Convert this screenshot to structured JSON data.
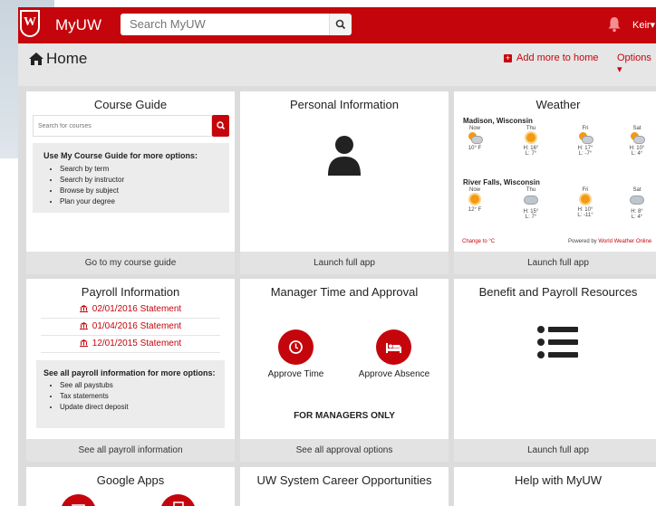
{
  "header": {
    "logo_letter": "W",
    "app_title": "MyUW",
    "search_placeholder": "Search MyUW",
    "user_name": "Keir▾"
  },
  "subheader": {
    "page_title": "Home",
    "add_more_label": "Add more to home",
    "options_label": "Options ▾"
  },
  "cards": {
    "course_guide": {
      "title": "Course Guide",
      "search_placeholder": "Search for courses",
      "box_heading": "Use My Course Guide for more options:",
      "box_items": [
        "Search by term",
        "Search by instructor",
        "Browse by subject",
        "Plan your degree"
      ],
      "footer": "Go to my course guide"
    },
    "personal_information": {
      "title": "Personal Information",
      "footer": "Launch full app"
    },
    "weather": {
      "title": "Weather",
      "locations": [
        {
          "name": "Madison, Wisconsin",
          "days": [
            {
              "day": "Now",
              "icon": "partly-cloudy-icon",
              "hi": "10° F",
              "lo": ""
            },
            {
              "day": "Thu",
              "icon": "sun-icon",
              "hi": "H: 16°",
              "lo": "L: 7°"
            },
            {
              "day": "Fri",
              "icon": "partly-cloudy-icon",
              "hi": "H: 17°",
              "lo": "L: -7°"
            },
            {
              "day": "Sat",
              "icon": "partly-cloudy-icon",
              "hi": "H: 10°",
              "lo": "L: 4°"
            }
          ]
        },
        {
          "name": "River Falls, Wisconsin",
          "days": [
            {
              "day": "Now",
              "icon": "sun-icon",
              "hi": "12° F",
              "lo": ""
            },
            {
              "day": "Thu",
              "icon": "cloud-icon",
              "hi": "H: 15°",
              "lo": "L: 7°"
            },
            {
              "day": "Fri",
              "icon": "sun-icon",
              "hi": "H: 10°",
              "lo": "L: -11°"
            },
            {
              "day": "Sat",
              "icon": "cloud-icon",
              "hi": "H: 8°",
              "lo": "L: 4°"
            }
          ]
        }
      ],
      "change_units": "Change to °C",
      "powered_prefix": "Powered by ",
      "powered_link": "World Weather Online",
      "footer": "Launch full app"
    },
    "payroll": {
      "title": "Payroll Information",
      "statements": [
        "02/01/2016 Statement",
        "01/04/2016 Statement",
        "12/01/2015 Statement"
      ],
      "box_heading": "See all payroll information for more options:",
      "box_items": [
        "See all paystubs",
        "Tax statements",
        "Update direct deposit"
      ],
      "footer": "See all payroll information"
    },
    "manager_time": {
      "title": "Manager Time and Approval",
      "approve_time": "Approve Time",
      "approve_absence": "Approve Absence",
      "note": "FOR MANAGERS ONLY",
      "footer": "See all approval options"
    },
    "benefit": {
      "title": "Benefit and Payroll Resources",
      "footer": "Launch full app"
    },
    "google_apps": {
      "title": "Google Apps"
    },
    "career": {
      "title": "UW System Career Opportunities"
    },
    "help": {
      "title": "Help with MyUW"
    }
  },
  "colors": {
    "brand_red": "#c5050c",
    "page_bg": "#dcdcdc",
    "footer_bg": "#e3e3e3"
  }
}
